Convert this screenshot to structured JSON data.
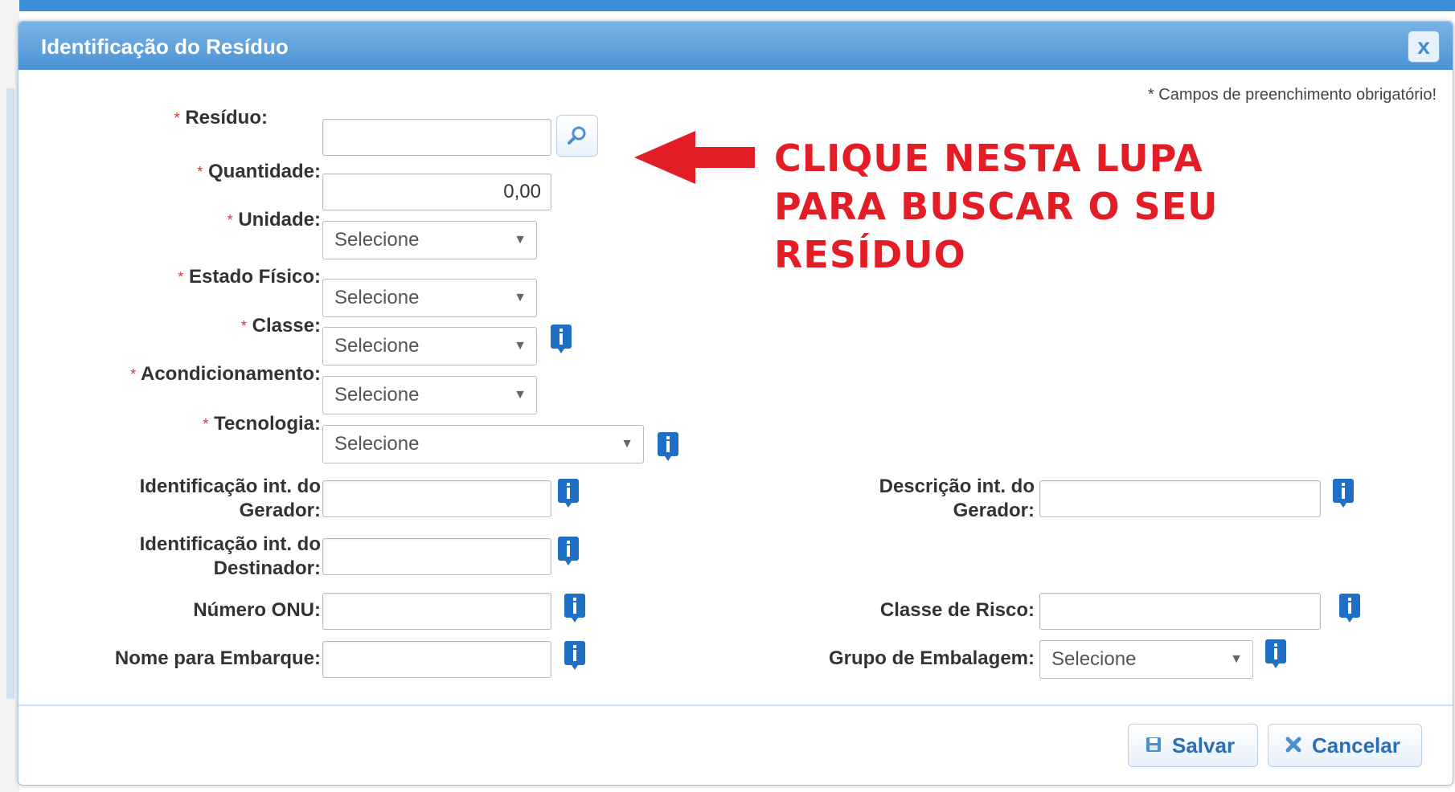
{
  "dialog": {
    "title": "Identificação do Resíduo",
    "close_icon": "x",
    "required_note": "* Campos de preenchimento obrigatório!"
  },
  "fields": {
    "residuo": {
      "label": "Resíduo:",
      "required": true,
      "value": ""
    },
    "quantidade": {
      "label": "Quantidade:",
      "required": true,
      "value": "0,00"
    },
    "unidade": {
      "label": "Unidade:",
      "required": true,
      "value": "Selecione"
    },
    "estado_fisico": {
      "label": "Estado Físico:",
      "required": true,
      "value": "Selecione"
    },
    "classe": {
      "label": "Classe:",
      "required": true,
      "value": "Selecione"
    },
    "acondicionamento": {
      "label": "Acondicionamento:",
      "required": true,
      "value": "Selecione"
    },
    "tecnologia": {
      "label": "Tecnologia:",
      "required": true,
      "value": "Selecione"
    },
    "ident_gerador": {
      "label_line1": "Identificação int. do",
      "label_line2": "Gerador:",
      "value": ""
    },
    "descr_gerador": {
      "label_line1": "Descrição int. do",
      "label_line2": "Gerador:",
      "value": ""
    },
    "ident_destinador": {
      "label_line1": "Identificação int. do",
      "label_line2": "Destinador:",
      "value": ""
    },
    "numero_onu": {
      "label": "Número ONU:",
      "value": ""
    },
    "classe_risco": {
      "label": "Classe de Risco:",
      "value": ""
    },
    "nome_embarque": {
      "label": "Nome para Embarque:",
      "value": ""
    },
    "grupo_embalagem": {
      "label": "Grupo de Embalagem:",
      "value": "Selecione"
    }
  },
  "annotation": {
    "line1": "CLIQUE NESTA LUPA",
    "line2": "PARA BUSCAR O SEU",
    "line3": "RESÍDUO",
    "color": "#e21d25"
  },
  "buttons": {
    "save": "Salvar",
    "cancel": "Cancelar"
  },
  "star": "*",
  "caret": "▼",
  "colors": {
    "title_bar": "#4a92d3",
    "accent": "#2a6fb5",
    "info_icon": "#1f6fc6"
  }
}
